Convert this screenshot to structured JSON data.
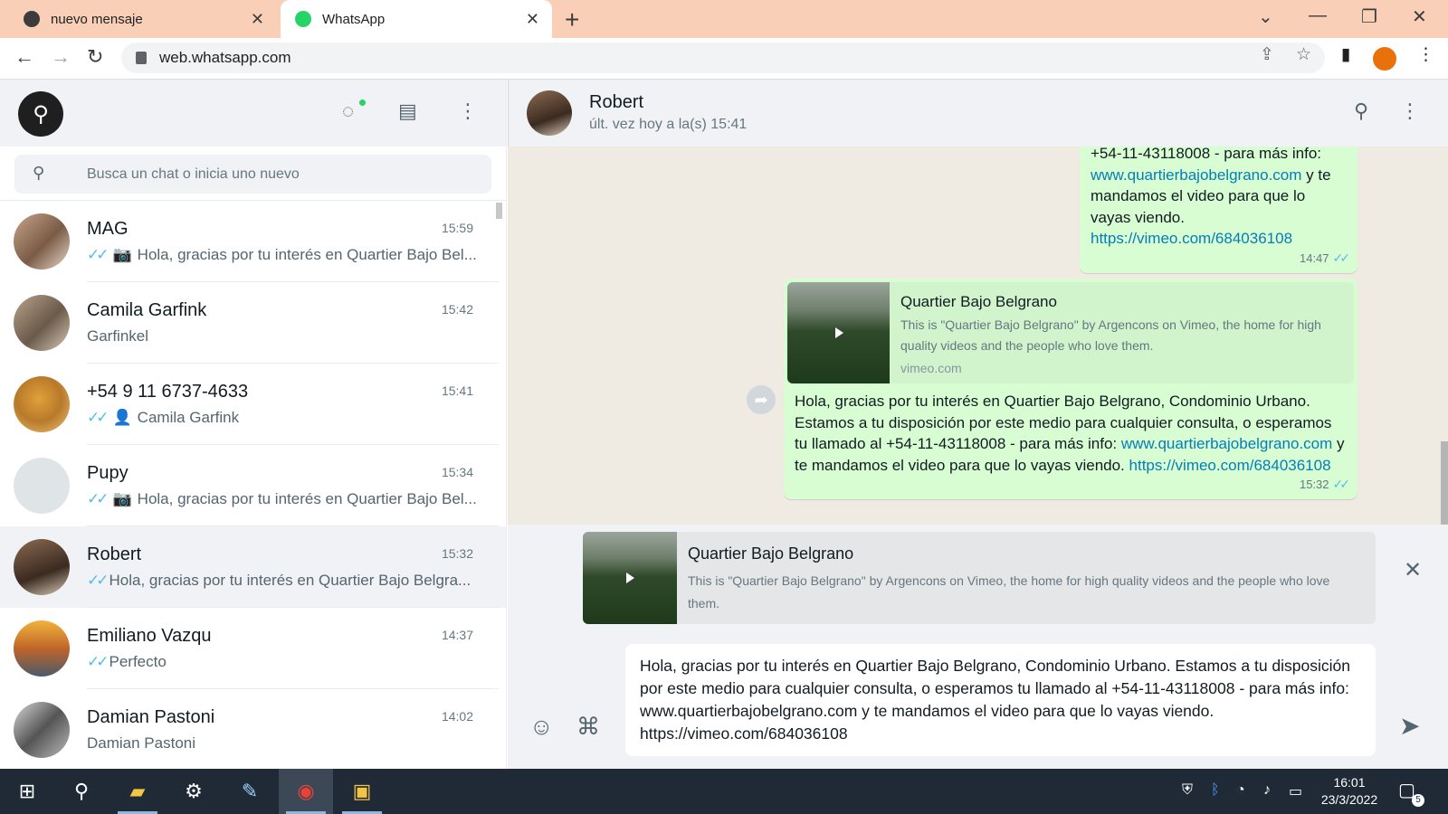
{
  "browser": {
    "tabs": [
      {
        "title": "nuevo mensaje"
      },
      {
        "title": "WhatsApp"
      }
    ],
    "url": "web.whatsapp.com"
  },
  "sidebar": {
    "search_placeholder": "Busca un chat o inicia uno nuevo",
    "chats": [
      {
        "name": "MAG",
        "time": "15:59",
        "preview": "Hola, gracias por tu interés en Quartier Bajo Bel...",
        "tick": "✓✓",
        "type_icon": "camera-icon",
        "type_glyph": "📷"
      },
      {
        "name": "Camila Garfink",
        "time": "15:42",
        "preview": "Garfinkel"
      },
      {
        "name": "+54 9 11 6737-4633",
        "time": "15:41",
        "preview": "Camila Garfink",
        "tick": "✓✓",
        "type_icon": "contact-icon",
        "type_glyph": "👤"
      },
      {
        "name": "Pupy",
        "time": "15:34",
        "preview": "Hola, gracias por tu interés en Quartier Bajo Bel...",
        "tick": "✓✓",
        "type_icon": "camera-icon",
        "type_glyph": "📷"
      },
      {
        "name": "Robert",
        "time": "15:32",
        "preview": "Hola, gracias por tu interés en Quartier Bajo Belgra...",
        "tick": "✓✓"
      },
      {
        "name": "Emiliano Vazqu",
        "time": "14:37",
        "preview": "Perfecto",
        "tick": "✓✓"
      },
      {
        "name": "Damian Pastoni",
        "time": "14:02",
        "preview": "Damian Pastoni"
      }
    ]
  },
  "conversation": {
    "contact_name": "Robert",
    "status": "últ. vez hoy a la(s) 15:41",
    "msg1": {
      "line1": "+54-11-43118008  - para más info:",
      "link1": "www.quartierbajobelgrano.com",
      "text2": " y te mandamos el video para que lo vayas viendo.",
      "link2": "https://vimeo.com/684036108",
      "time": "14:47",
      "tick": "✓✓"
    },
    "msg2": {
      "preview_title": "Quartier Bajo Belgrano",
      "preview_desc": "This is \"Quartier Bajo Belgrano\" by Argencons on Vimeo, the home for high quality videos and the people who love them.",
      "preview_domain": "vimeo.com",
      "text1": "Hola, gracias por tu interés en Quartier Bajo Belgrano, Condominio Urbano. Estamos a tu disposición por este medio para cualquier consulta, o esperamos tu llamado al +54-11-43118008  - para más info: ",
      "link1": "www.quartierbajobelgrano.com",
      "text2": " y te mandamos el video para que lo vayas viendo. ",
      "link2": "https://vimeo.com/684036108",
      "time": "15:32",
      "tick": "✓✓"
    }
  },
  "link_preview": {
    "title": "Quartier Bajo Belgrano",
    "desc": "This is \"Quartier Bajo Belgrano\" by Argencons on Vimeo, the home for high quality videos and the people who love them."
  },
  "composer": {
    "value": "Hola, gracias por tu interés en Quartier Bajo Belgrano, Condominio Urbano. Estamos a tu disposición por este medio para cualquier consulta, o esperamos tu llamado al +54-11-43118008  - para más info: www.quartierbajobelgrano.com y te mandamos el video para que lo vayas viendo. https://vimeo.com/684036108"
  },
  "taskbar": {
    "time": "16:01",
    "date": "23/3/2022",
    "notifications": "5"
  }
}
